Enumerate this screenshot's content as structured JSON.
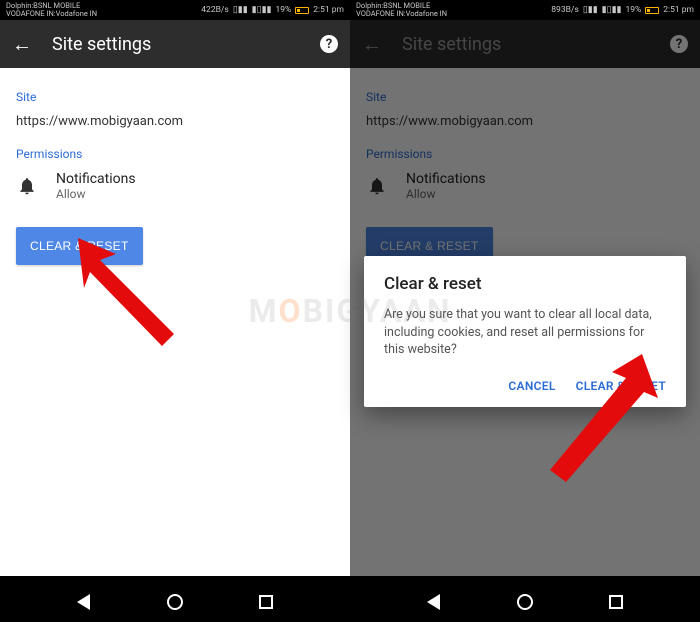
{
  "watermark": {
    "pre": "M",
    "o": "O",
    "post": "BIGYAAN"
  },
  "left": {
    "status": {
      "carrier1": "Dolphin:BSNL MOBILE",
      "carrier2": "VODAFONE IN:Vodafone IN",
      "speed": "422B/s",
      "signal": "▯▮▮",
      "signal2": "▮▯▮▮",
      "pct": "19%",
      "time": "2:51 pm"
    },
    "appbar": {
      "title": "Site settings"
    },
    "section_site": "Site",
    "site_url": "https://www.mobigyaan.com",
    "section_perm": "Permissions",
    "perm": {
      "title": "Notifications",
      "sub": "Allow"
    },
    "clear_btn": "CLEAR & RESET"
  },
  "right": {
    "status": {
      "carrier1": "Dolphin:BSNL MOBILE",
      "carrier2": "VODAFONE IN:Vodafone IN",
      "speed": "893B/s",
      "signal": "▯▮▮",
      "signal2": "▮▯▮▮",
      "pct": "19%",
      "time": "2:51 pm"
    },
    "appbar": {
      "title": "Site settings"
    },
    "section_site": "Site",
    "site_url": "https://www.mobigyaan.com",
    "section_perm": "Permissions",
    "perm": {
      "title": "Notifications",
      "sub": "Allow"
    },
    "clear_btn": "CLEAR & RESET",
    "dialog": {
      "title": "Clear & reset",
      "body": "Are you sure that you want to clear all local data, including cookies, and reset all permissions for this website?",
      "cancel": "CANCEL",
      "confirm": "CLEAR & RESET"
    }
  }
}
